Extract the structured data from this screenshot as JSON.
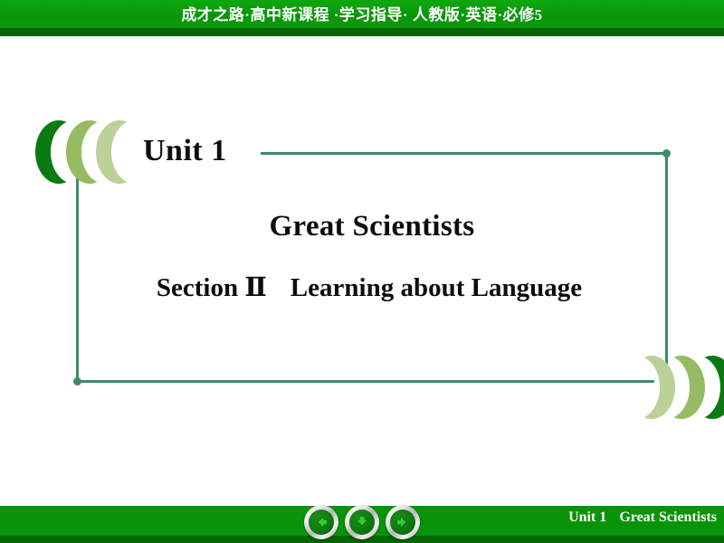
{
  "header": {
    "title": "成才之路·高中新课程 ·学习指导· 人教版·英语·必修5"
  },
  "slide": {
    "unit_label": "Unit 1",
    "main_title": "Great Scientists",
    "section_label": "Section Ⅱ",
    "section_title": "Learning about Language"
  },
  "footer": {
    "unit_label": "Unit 1",
    "course_title": "Great Scientists",
    "nav": [
      {
        "name": "previous",
        "icon": "arrow-left-icon"
      },
      {
        "name": "down",
        "icon": "arrow-down-icon"
      },
      {
        "name": "next",
        "icon": "arrow-right-icon"
      }
    ]
  },
  "colors": {
    "header_green": "#089408",
    "header_dark_green": "#056405",
    "frame_line": "#3d8c66",
    "crescent_dark": "#0b7a12",
    "crescent_mid": "#96bb63",
    "crescent_light": "#bcd197",
    "arrow_green": "#1faa1f"
  }
}
